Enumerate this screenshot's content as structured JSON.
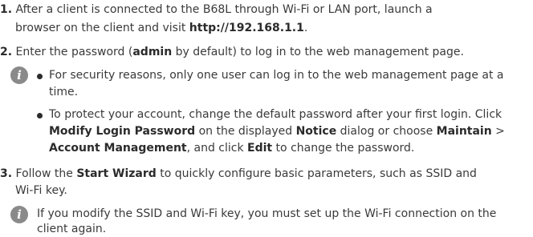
{
  "step1": {
    "num": "1.",
    "line1": "After a client is connected to the B68L through Wi-Fi or LAN port, launch a",
    "line2_pre": "browser on the client and visit ",
    "url": "http://192.168.1.1",
    "line2_post": "."
  },
  "step2": {
    "num": "2.",
    "pre": "Enter the password (",
    "bold": "admin",
    "post": " by default) to log in to the web management page."
  },
  "note1": {
    "icon": "info-icon",
    "bullet1_line1": "For security reasons, only one user can log in to the web management page at a",
    "bullet1_line2": "time.",
    "bullet2_line1": "To protect your account, change the default password after your first login. Click",
    "b2_modify": "Modify Login Password",
    "b2_mid1": " on the displayed ",
    "b2_notice": "Notice",
    "b2_mid2": " dialog or choose ",
    "b2_maintain": "Maintain",
    "b2_gt": " >",
    "b2_account": "Account Management",
    "b2_mid3": ", and click ",
    "b2_edit": "Edit",
    "b2_end": " to change the password."
  },
  "step3": {
    "num": "3.",
    "pre": "Follow the ",
    "bold": "Start Wizard",
    "post": " to quickly configure basic parameters, such as SSID and",
    "line2": "Wi-Fi key."
  },
  "note2": {
    "icon": "info-icon",
    "line1": "If you modify the SSID and Wi-Fi key, you must set up the Wi-Fi connection on the",
    "line2": "client again."
  }
}
